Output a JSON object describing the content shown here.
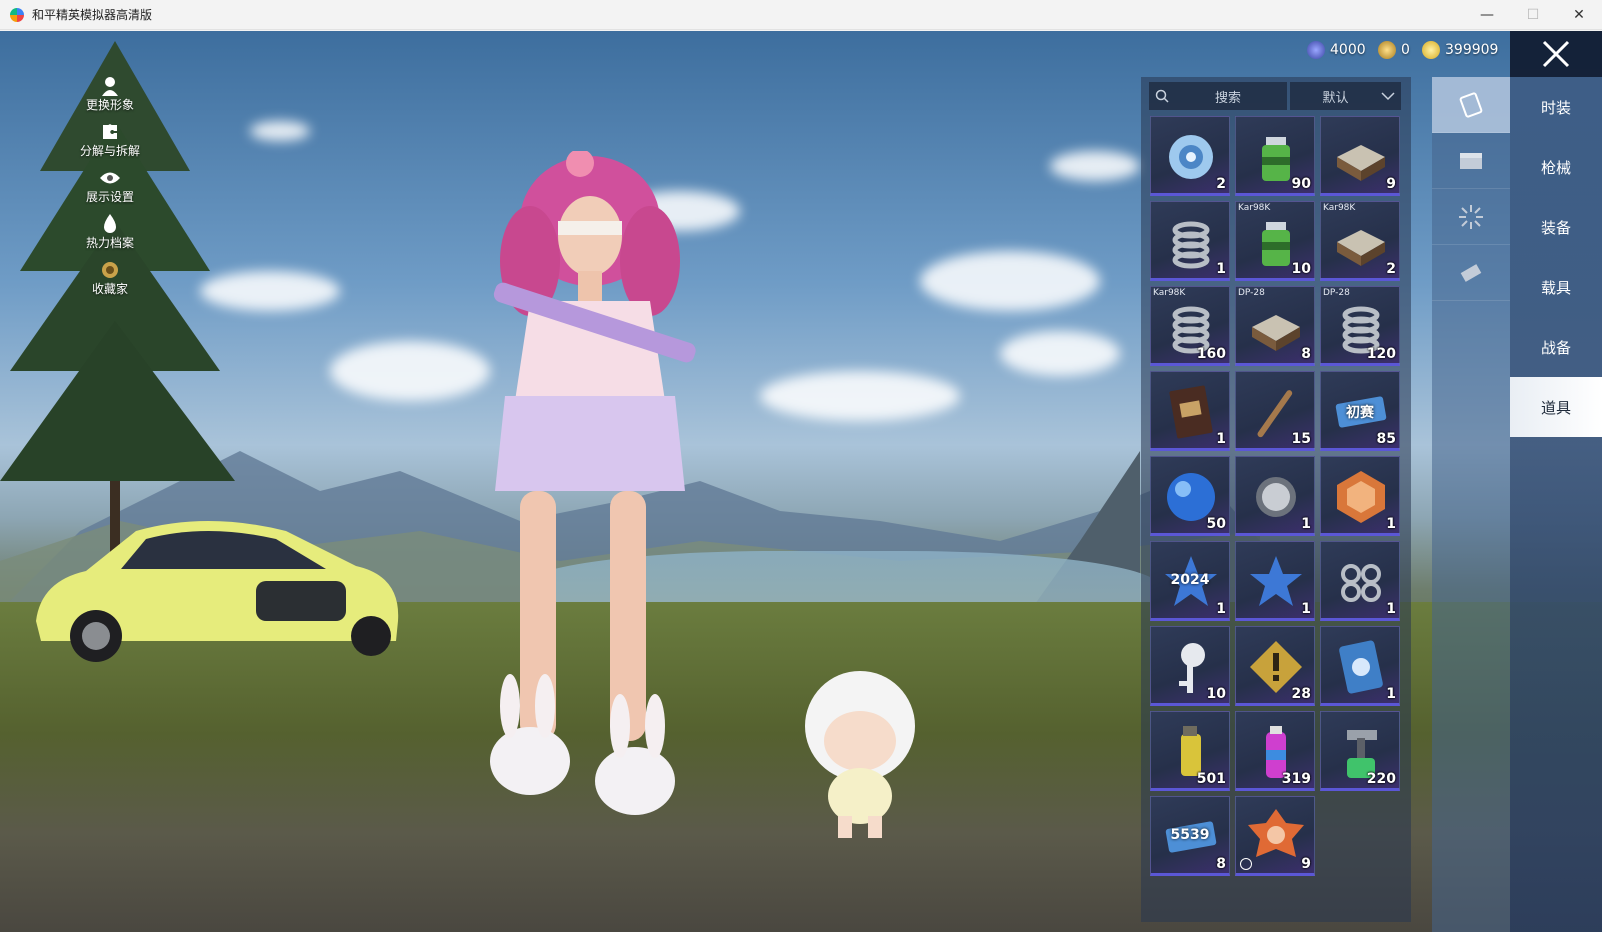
{
  "window": {
    "title": "和平精英模拟器高清版",
    "controls": [
      "—",
      "☐",
      "✕"
    ]
  },
  "currency": [
    {
      "icon": "globe-token-icon",
      "value": "4000",
      "color": "#6b7bd6"
    },
    {
      "icon": "gold-emblem-icon",
      "value": "0",
      "color": "#e0b43a"
    },
    {
      "icon": "coin-icon",
      "value": "399909",
      "color": "#f4d04d"
    }
  ],
  "left_menu": [
    {
      "label": "更换形象",
      "icon": "person-icon"
    },
    {
      "label": "分解与拆解",
      "icon": "puzzle-icon"
    },
    {
      "label": "展示设置",
      "icon": "eye-icon"
    },
    {
      "label": "热力档案",
      "icon": "flame-icon"
    },
    {
      "label": "收藏家",
      "icon": "collector-badge-icon"
    }
  ],
  "categories": [
    {
      "label": "时装",
      "active": false
    },
    {
      "label": "枪械",
      "active": false
    },
    {
      "label": "装备",
      "active": false
    },
    {
      "label": "载具",
      "active": false
    },
    {
      "label": "战备",
      "active": false
    },
    {
      "label": "道具",
      "active": true
    }
  ],
  "sub_tabs": [
    {
      "icon": "card-icon",
      "active": true
    },
    {
      "icon": "chest-icon",
      "active": false
    },
    {
      "icon": "firework-icon",
      "active": false
    },
    {
      "icon": "ticket-icon",
      "active": false
    }
  ],
  "inventory": {
    "search_placeholder": "搜索",
    "sort_label": "默认",
    "items": [
      {
        "name": "scope-lens",
        "tag": "",
        "count": "2",
        "icon": "lens-icon"
      },
      {
        "name": "green-canister",
        "tag": "",
        "count": "90",
        "icon": "canister-icon"
      },
      {
        "name": "weapon-chest",
        "tag": "",
        "count": "9",
        "icon": "crate-icon"
      },
      {
        "name": "spring",
        "tag": "",
        "count": "1",
        "icon": "spring-icon"
      },
      {
        "name": "green-canister",
        "tag": "Kar98K",
        "count": "10",
        "icon": "canister-icon"
      },
      {
        "name": "weapon-chest",
        "tag": "Kar98K",
        "count": "2",
        "icon": "crate-icon"
      },
      {
        "name": "spring",
        "tag": "Kar98K",
        "count": "160",
        "icon": "spring-icon"
      },
      {
        "name": "weapon-chest",
        "tag": "DP-28",
        "count": "8",
        "icon": "crate-icon"
      },
      {
        "name": "spring",
        "tag": "DP-28",
        "count": "120",
        "icon": "spring-icon"
      },
      {
        "name": "id-card",
        "tag": "",
        "count": "1",
        "icon": "id-book-icon"
      },
      {
        "name": "wood-stick",
        "tag": "",
        "count": "15",
        "icon": "stick-icon"
      },
      {
        "name": "qualifier-ticket",
        "tag": "",
        "count": "85",
        "icon": "ticket-icon",
        "text": "初赛"
      },
      {
        "name": "puzzle-orb",
        "tag": "",
        "count": "50",
        "icon": "orb-icon"
      },
      {
        "name": "thumb-coin",
        "tag": "",
        "count": "1",
        "icon": "coin-icon"
      },
      {
        "name": "medal-badge",
        "tag": "",
        "count": "1",
        "icon": "medal-icon"
      },
      {
        "name": "star-2024",
        "tag": "",
        "count": "1",
        "icon": "star-icon",
        "text": "2024"
      },
      {
        "name": "green-star",
        "tag": "",
        "count": "1",
        "icon": "star-icon"
      },
      {
        "name": "gear-parts",
        "tag": "",
        "count": "1",
        "icon": "parts-icon"
      },
      {
        "name": "key",
        "tag": "",
        "count": "10",
        "icon": "key-icon"
      },
      {
        "name": "alert-token",
        "tag": "",
        "count": "28",
        "icon": "alert-icon"
      },
      {
        "name": "blue-card",
        "tag": "",
        "count": "1",
        "icon": "card-icon"
      },
      {
        "name": "smoke-grenade",
        "tag": "",
        "count": "501",
        "icon": "grenade-icon"
      },
      {
        "name": "spray-can",
        "tag": "",
        "count": "319",
        "icon": "spray-icon"
      },
      {
        "name": "spray-gun",
        "tag": "",
        "count": "220",
        "icon": "spray-gun-icon"
      },
      {
        "name": "gold-ticket",
        "tag": "",
        "count": "8",
        "icon": "ticket-icon",
        "text": "5539"
      },
      {
        "name": "timed-badge",
        "tag": "",
        "count": "9",
        "icon": "badge-icon",
        "timed": true
      }
    ]
  }
}
